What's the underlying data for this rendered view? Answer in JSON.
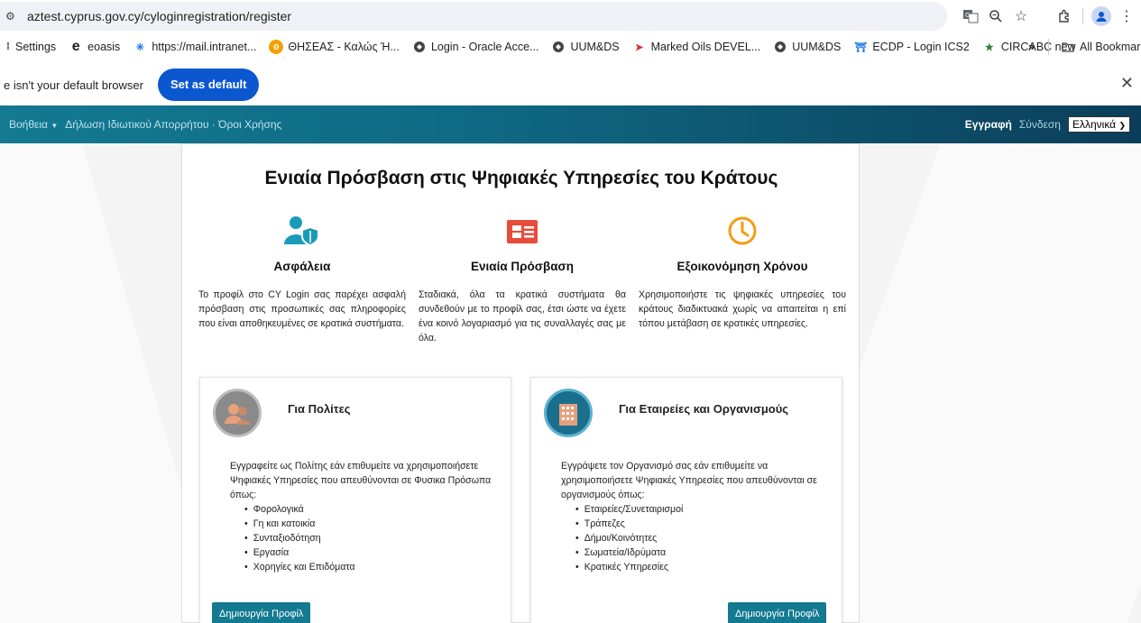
{
  "browser": {
    "url": "aztest.cyprus.gov.cy/cyloginregistration/register",
    "bookmarks": [
      {
        "label": "Settings",
        "icon": "settings-icon"
      },
      {
        "label": "eoasis",
        "icon": "edge-icon"
      },
      {
        "label": "https://mail.intranet...",
        "icon": "mail-icon"
      },
      {
        "label": "ΘΗΣΕΑΣ - Καλώς Ή...",
        "icon": "site-icon"
      },
      {
        "label": "Login - Oracle Acce...",
        "icon": "globe-icon"
      },
      {
        "label": "UUM&DS",
        "icon": "globe-icon"
      },
      {
        "label": "Marked Oils DEVEL...",
        "icon": "site-icon"
      },
      {
        "label": "UUM&DS",
        "icon": "globe-icon"
      },
      {
        "label": "ECDP - Login ICS2",
        "icon": "site-icon"
      },
      {
        "label": "CIRCABC new",
        "icon": "site-icon"
      }
    ],
    "more_bookmarks": "»",
    "all_bookmarks": "All Bookmark",
    "default_message": "e isn't your default browser",
    "set_default": "Set as default"
  },
  "nav": {
    "help": "Βοήθεια",
    "privacy": "Δήλωση Ιδιωτικού Απορρήτου · Όροι Χρήσης",
    "register": "Εγγραφή",
    "login": "Σύνδεση",
    "language": "Ελληνικά"
  },
  "main": {
    "title": "Ενιαία Πρόσβαση στις Ψηφιακές Υπηρεσίες του Κράτους",
    "features": [
      {
        "title": "Ασφάλεια",
        "text": "Το προφίλ στο CY Login σας παρέχει ασφαλή πρόσβαση στις προσωπικές σας πληροφορίες που είναι αποθηκευμένες σε κρατικά συστήματα."
      },
      {
        "title": "Ενιαία Πρόσβαση",
        "text": "Σταδιακά, όλα τα κρατικά συστήματα θα συνδεθούν με το προφίλ σας, έτσι ώστε να έχετε ένα κοινό λογαριασμό για τις συναλλαγές σας με όλα."
      },
      {
        "title": "Εξοικονόμηση Χρόνου",
        "text": "Χρησιμοποιήστε τις ψηφιακές υπηρεσίες του κράτους διαδικτυακά χωρίς να απαιτείται η επί τόπου μετάβαση σε κρατικές υπηρεσίες."
      }
    ],
    "colors": {
      "accent": "#137a91",
      "orange": "#f39c12",
      "red": "#e74c3c",
      "teal_icon": "#1a9bb8"
    }
  },
  "citizens": {
    "title": "Για Πολίτες",
    "desc": "Εγγραφείτε ως Πολίτης εάν επιθυμείτε να χρησιμοποιήσετε Ψηφιακές Υπηρεσίες που απευθύνονται σε Φυσικα Πρόσωπα όπως:",
    "items": [
      "Φορολογικά",
      "Γη και κατοικία",
      "Συνταξιοδότηση",
      "Εργασία",
      "Χορηγίες και Επιδόματα"
    ],
    "button": "Δημιουργία Προφίλ"
  },
  "organizations": {
    "title": "Για Εταιρείες και Οργανισμούς",
    "desc": "Εγγράψετε τον Οργανισμό σας εάν επιθυμείτε να χρησιμοποιήσετε Ψηφιακές Υπηρεσίες που απευθύνονται σε οργανισμούς όπως:",
    "items": [
      "Εταιρείες/Συνεταιρισμοί",
      "Τράπεζες",
      "Δήμοι/Κοινότητες",
      "Σωματεία/Ιδρύματα",
      "Κρατικές Υπηρεσίες"
    ],
    "button": "Δημιουργία Προφίλ"
  }
}
